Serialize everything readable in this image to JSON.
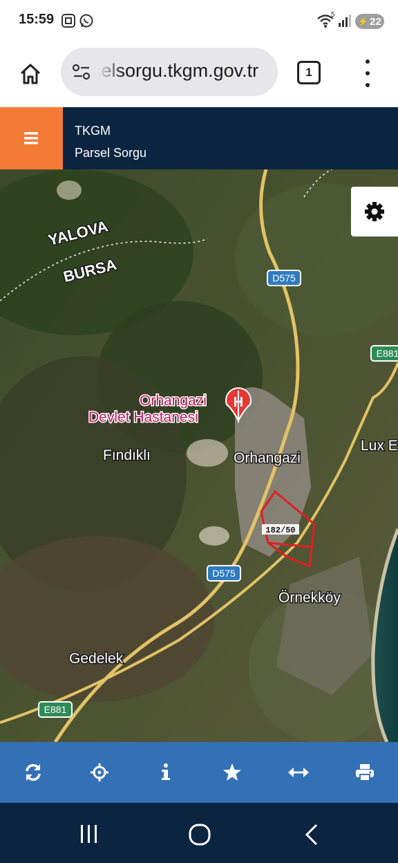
{
  "status_bar": {
    "time": "15:59",
    "signal_badge": "5",
    "battery_level": "22",
    "icons": [
      "screenshot-icon",
      "whatsapp-icon",
      "wifi-icon",
      "signal-icon",
      "battery-icon"
    ]
  },
  "browser": {
    "url": "parselsorgu.tkgm.gov.tr",
    "tab_count": "1",
    "icons": [
      "home-icon",
      "site-settings-icon",
      "menu-icon"
    ]
  },
  "app_header": {
    "title": "TKGM",
    "subtitle": "Parsel Sorgu",
    "accent_color": "#f47b35",
    "background_color": "#0b2541"
  },
  "map": {
    "labels": {
      "yalova": "YALOVA",
      "bursa": "BURSA",
      "hospital_line1": "Orhangazi",
      "hospital_line2": "Devlet Hastanesi",
      "findikli": "Fındıklı",
      "orhangazi": "Orhangazi",
      "ornekkoy": "Örnekköy",
      "gedelek": "Gedelek",
      "lux": "Lux E"
    },
    "road_shields": {
      "d575_top": "D575",
      "d575_bottom": "D575",
      "e881_right": "E881",
      "e881_bottom": "E881"
    },
    "parcel_label": "182/50",
    "parcel_color": "#e02020"
  },
  "toolbar": {
    "background_color": "#3470b5",
    "icons": [
      "refresh-icon",
      "locate-icon",
      "info-icon",
      "favorite-icon",
      "measure-icon",
      "print-icon"
    ]
  },
  "navbar": {
    "icons": [
      "recent-apps-icon",
      "home-nav-icon",
      "back-icon"
    ]
  }
}
